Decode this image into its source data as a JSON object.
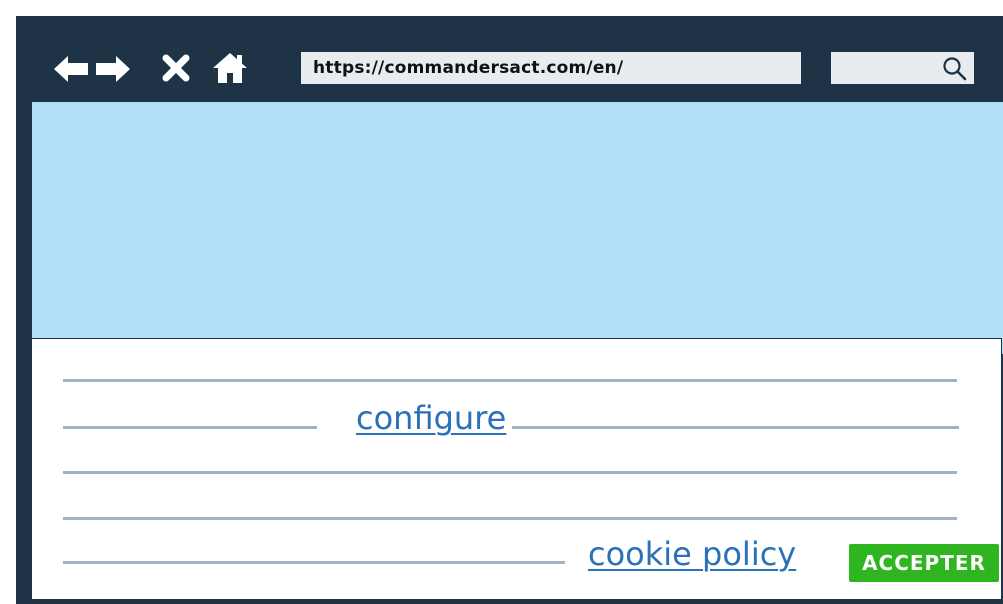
{
  "toolbar": {
    "icons": [
      "back-arrow-icon",
      "forward-arrow-icon",
      "close-icon",
      "home-icon"
    ],
    "url": "https://commandersact.com/en/",
    "search_icon": "search-icon"
  },
  "consent": {
    "configure_label": "configure",
    "cookie_policy_label": "cookie policy",
    "accept_label": "ACCEPTER"
  },
  "colors": {
    "frame": "#1f3346",
    "hero": "#b2e0fb",
    "text_line": "#a3b1c4",
    "link": "#2a71b8",
    "accept": "#2fb51f"
  }
}
